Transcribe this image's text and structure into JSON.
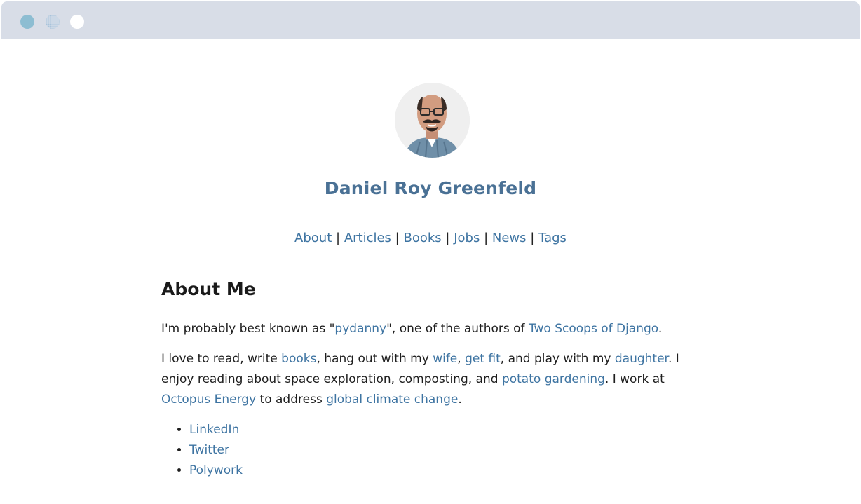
{
  "window": {
    "controls": [
      "close",
      "minimize",
      "maximize"
    ]
  },
  "header": {
    "avatar_alt": "Daniel Roy Greenfeld",
    "title": "Daniel Roy Greenfeld"
  },
  "nav": {
    "items": [
      "About",
      "Articles",
      "Books",
      "Jobs",
      "News",
      "Tags"
    ],
    "separator": "|"
  },
  "main": {
    "heading": "About Me",
    "p1": {
      "t1": "I'm probably best known as \"",
      "link1": "pydanny",
      "t2": "\", one of the authors of ",
      "link2": "Two Scoops of Django",
      "t3": "."
    },
    "p2": {
      "t1": "I love to read, write ",
      "books": "books",
      "t2": ", hang out with my ",
      "wife": "wife",
      "t3": ", ",
      "getfit": "get fit",
      "t4": ", and play with my ",
      "daughter": "daughter",
      "t5": ". I enjoy reading about space exploration, composting, and ",
      "potato": "potato gardening",
      "t6": ". I work at ",
      "octopus": "Octopus Energy",
      "t7": " to address ",
      "climate": "global climate change",
      "t8": "."
    },
    "links": [
      "LinkedIn",
      "Twitter",
      "Polywork"
    ]
  },
  "colors": {
    "link": "#3e74a2",
    "title": "#4a7195",
    "titlebar": "#d8dde7"
  }
}
